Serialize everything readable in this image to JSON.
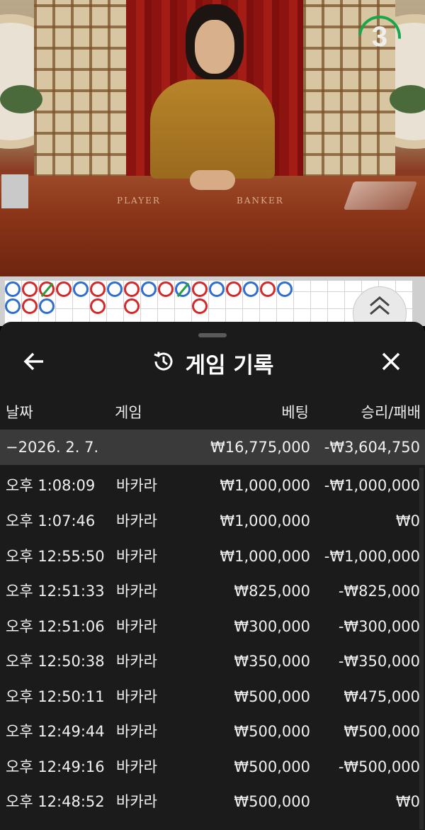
{
  "video": {
    "countdown": "3",
    "table_labels": {
      "player": "PLAYER",
      "banker": "BANKER"
    }
  },
  "colors": {
    "player": "#2f6fd1",
    "banker": "#d32a2a",
    "tie": "#23a03a",
    "sheet_bg": "#1b1b1b",
    "summary_bg": "#3a3a3a"
  },
  "scoreboard": {
    "beads": [
      {
        "col": 0,
        "row": 0,
        "side": "player"
      },
      {
        "col": 1,
        "row": 0,
        "side": "banker"
      },
      {
        "col": 2,
        "row": 0,
        "side": "banker",
        "tie": true
      },
      {
        "col": 3,
        "row": 0,
        "side": "banker"
      },
      {
        "col": 4,
        "row": 0,
        "side": "player"
      },
      {
        "col": 5,
        "row": 0,
        "side": "banker"
      },
      {
        "col": 6,
        "row": 0,
        "side": "player"
      },
      {
        "col": 7,
        "row": 0,
        "side": "banker"
      },
      {
        "col": 8,
        "row": 0,
        "side": "player"
      },
      {
        "col": 9,
        "row": 0,
        "side": "banker"
      },
      {
        "col": 10,
        "row": 0,
        "side": "player",
        "tie": true
      },
      {
        "col": 11,
        "row": 0,
        "side": "banker"
      },
      {
        "col": 12,
        "row": 0,
        "side": "player"
      },
      {
        "col": 13,
        "row": 0,
        "side": "banker"
      },
      {
        "col": 14,
        "row": 0,
        "side": "player"
      },
      {
        "col": 15,
        "row": 0,
        "side": "banker"
      },
      {
        "col": 16,
        "row": 0,
        "side": "player"
      },
      {
        "col": 0,
        "row": 1,
        "side": "player"
      },
      {
        "col": 1,
        "row": 1,
        "side": "banker"
      },
      {
        "col": 2,
        "row": 1,
        "side": "player"
      },
      {
        "col": 5,
        "row": 1,
        "side": "banker"
      },
      {
        "col": 7,
        "row": 1,
        "side": "banker"
      },
      {
        "col": 11,
        "row": 1,
        "side": "banker"
      }
    ],
    "toggle_icon": "double-chevron-up-icon"
  },
  "history": {
    "title": "게임 기록",
    "title_icon": "history-clock-icon",
    "back_icon": "arrow-left-icon",
    "close_icon": "close-icon",
    "columns": {
      "date": "날짜",
      "game": "게임",
      "bet": "베팅",
      "win_loss": "승리/패배"
    },
    "summary": {
      "date": "−2026. 2. 7.",
      "bet": "₩16,775,000",
      "win_loss": "-₩3,604,750"
    },
    "rows": [
      {
        "time": "오후 1:08:09",
        "game": "바카라",
        "bet": "₩1,000,000",
        "win_loss": "-₩1,000,000"
      },
      {
        "time": "오후 1:07:46",
        "game": "바카라",
        "bet": "₩1,000,000",
        "win_loss": "₩0"
      },
      {
        "time": "오후 12:55:50",
        "game": "바카라",
        "bet": "₩1,000,000",
        "win_loss": "-₩1,000,000"
      },
      {
        "time": "오후 12:51:33",
        "game": "바카라",
        "bet": "₩825,000",
        "win_loss": "-₩825,000"
      },
      {
        "time": "오후 12:51:06",
        "game": "바카라",
        "bet": "₩300,000",
        "win_loss": "-₩300,000"
      },
      {
        "time": "오후 12:50:38",
        "game": "바카라",
        "bet": "₩350,000",
        "win_loss": "-₩350,000"
      },
      {
        "time": "오후 12:50:11",
        "game": "바카라",
        "bet": "₩500,000",
        "win_loss": "₩475,000"
      },
      {
        "time": "오후 12:49:44",
        "game": "바카라",
        "bet": "₩500,000",
        "win_loss": "₩500,000"
      },
      {
        "time": "오후 12:49:16",
        "game": "바카라",
        "bet": "₩500,000",
        "win_loss": "-₩500,000"
      },
      {
        "time": "오후 12:48:52",
        "game": "바카라",
        "bet": "₩500,000",
        "win_loss": "₩0"
      }
    ]
  }
}
